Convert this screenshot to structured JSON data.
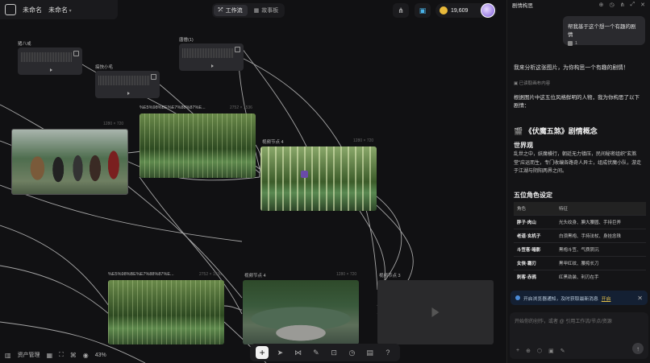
{
  "topbar": {
    "crumb_primary": "未命名",
    "crumb_secondary": "未命名",
    "mode_tabs": [
      "工作流",
      "故事板"
    ],
    "credits": "19,609"
  },
  "nodes": {
    "audio1": {
      "label": "猪八戒"
    },
    "audio2": {
      "label": "唐僧(1)"
    },
    "audio3": {
      "label": "搞快小毛"
    },
    "img_people": {
      "dim": "1280 × 720"
    },
    "img_bamboo1": {
      "label": "%E5%98%BE%E7%88%87%E...",
      "dim": "2752 × 1536"
    },
    "video1": {
      "label": "视频节点 4",
      "dim": "1280 × 720"
    },
    "img_bamboo2": {
      "label": "%E5%98%BE%E7%88%87%E...",
      "dim": "2752 × 1536"
    },
    "video2": {
      "label": "视频节点 4",
      "dim": "1280 × 720"
    },
    "video3": {
      "label": "视频节点 3"
    }
  },
  "statusbar": {
    "assets": "资产管理",
    "zoom": "43%"
  },
  "panel": {
    "title": "剧情构思",
    "user_msg": "帮我基于这个想一个有趣的剧情",
    "attach_count": "1",
    "p1": "我来分析这张图片，为你构思一个有趣的剧情！",
    "read": "已读取画布内容",
    "p2": "根据图片中这五位风格鲜明的人物，我为你构思了以下剧情：",
    "h1": "《伏魔五煞》剧情概念",
    "h2": "世界观",
    "p3": "乱世之中，妖魔横行，朝廷无力镇压，民间秘密组织\"玄煞堂\"应运而生，专门收编各路奇人异士，组成伏魔小队，游走于江湖与阴阳两界之间。",
    "h3": "五位角色设定",
    "table": {
      "headers": [
        "角色",
        "特征"
      ],
      "rows": [
        [
          "胖子·肉山",
          "光头纹身、腆大腰圆、手持巨斧"
        ],
        [
          "老道·玄机子",
          "白须黑袍、手持法杖、身挂念珠"
        ],
        [
          "斗笠客·暗影",
          "黑袍斗笠、气质阴沉"
        ],
        [
          "女侠·霜刃",
          "黑甲红纹、腰挎长刀"
        ],
        [
          "刺客·赤鸦",
          "红黑劲装、利刃在手"
        ]
      ]
    },
    "notice": "开启浏览器通知，及时获取最新消息",
    "notice_link": "开启",
    "input_placeholder": "开始你的创作，或者 @ 引用工作流/节点/资源"
  }
}
